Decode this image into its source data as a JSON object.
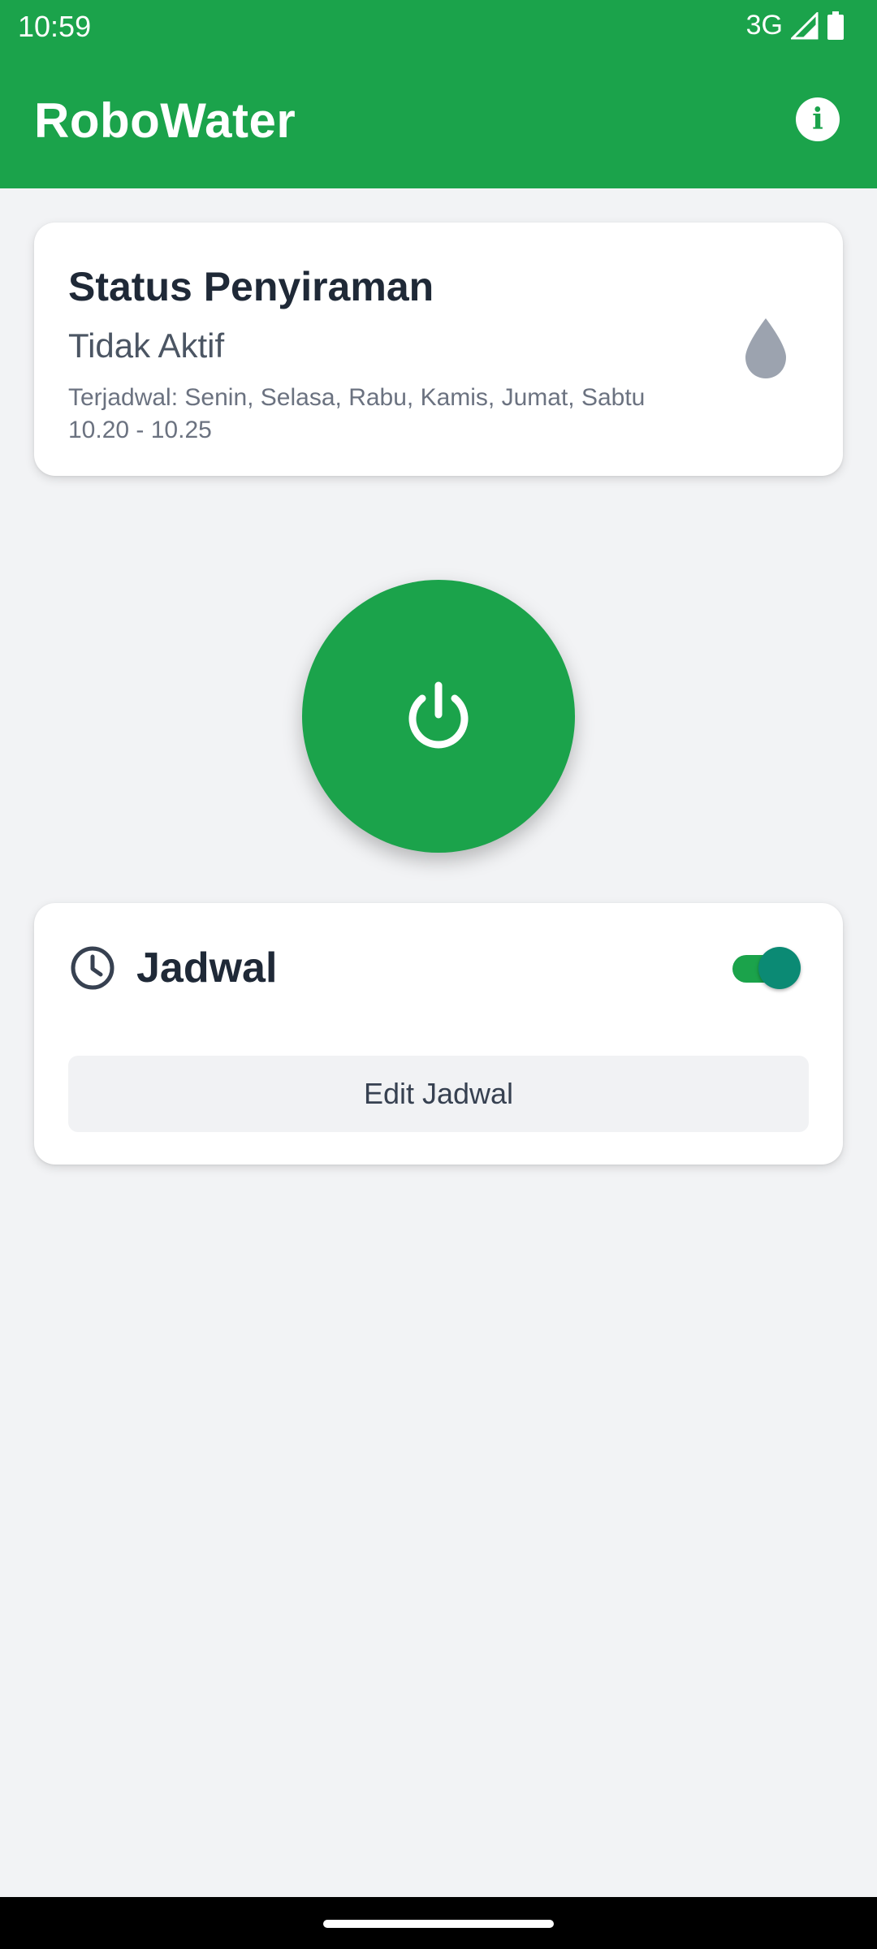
{
  "status_bar": {
    "time": "10:59",
    "network": "3G"
  },
  "app_bar": {
    "title": "RoboWater",
    "info_icon": "info-icon"
  },
  "status_card": {
    "title": "Status Penyiraman",
    "state": "Tidak Aktif",
    "schedule_days": "Terjadwal: Senin, Selasa, Rabu, Kamis, Jumat, Sabtu",
    "schedule_time": "10.20 - 10.25",
    "icon": "water-drop-icon",
    "icon_color": "#9ca3af"
  },
  "power_button": {
    "icon": "power-icon",
    "color": "#1ba34b"
  },
  "schedule_card": {
    "title": "Jadwal",
    "icon": "clock-icon",
    "toggle_on": true,
    "edit_label": "Edit Jadwal"
  },
  "colors": {
    "primary": "#1ba34b",
    "toggle_thumb": "#0b8a74",
    "background": "#f2f3f5"
  }
}
